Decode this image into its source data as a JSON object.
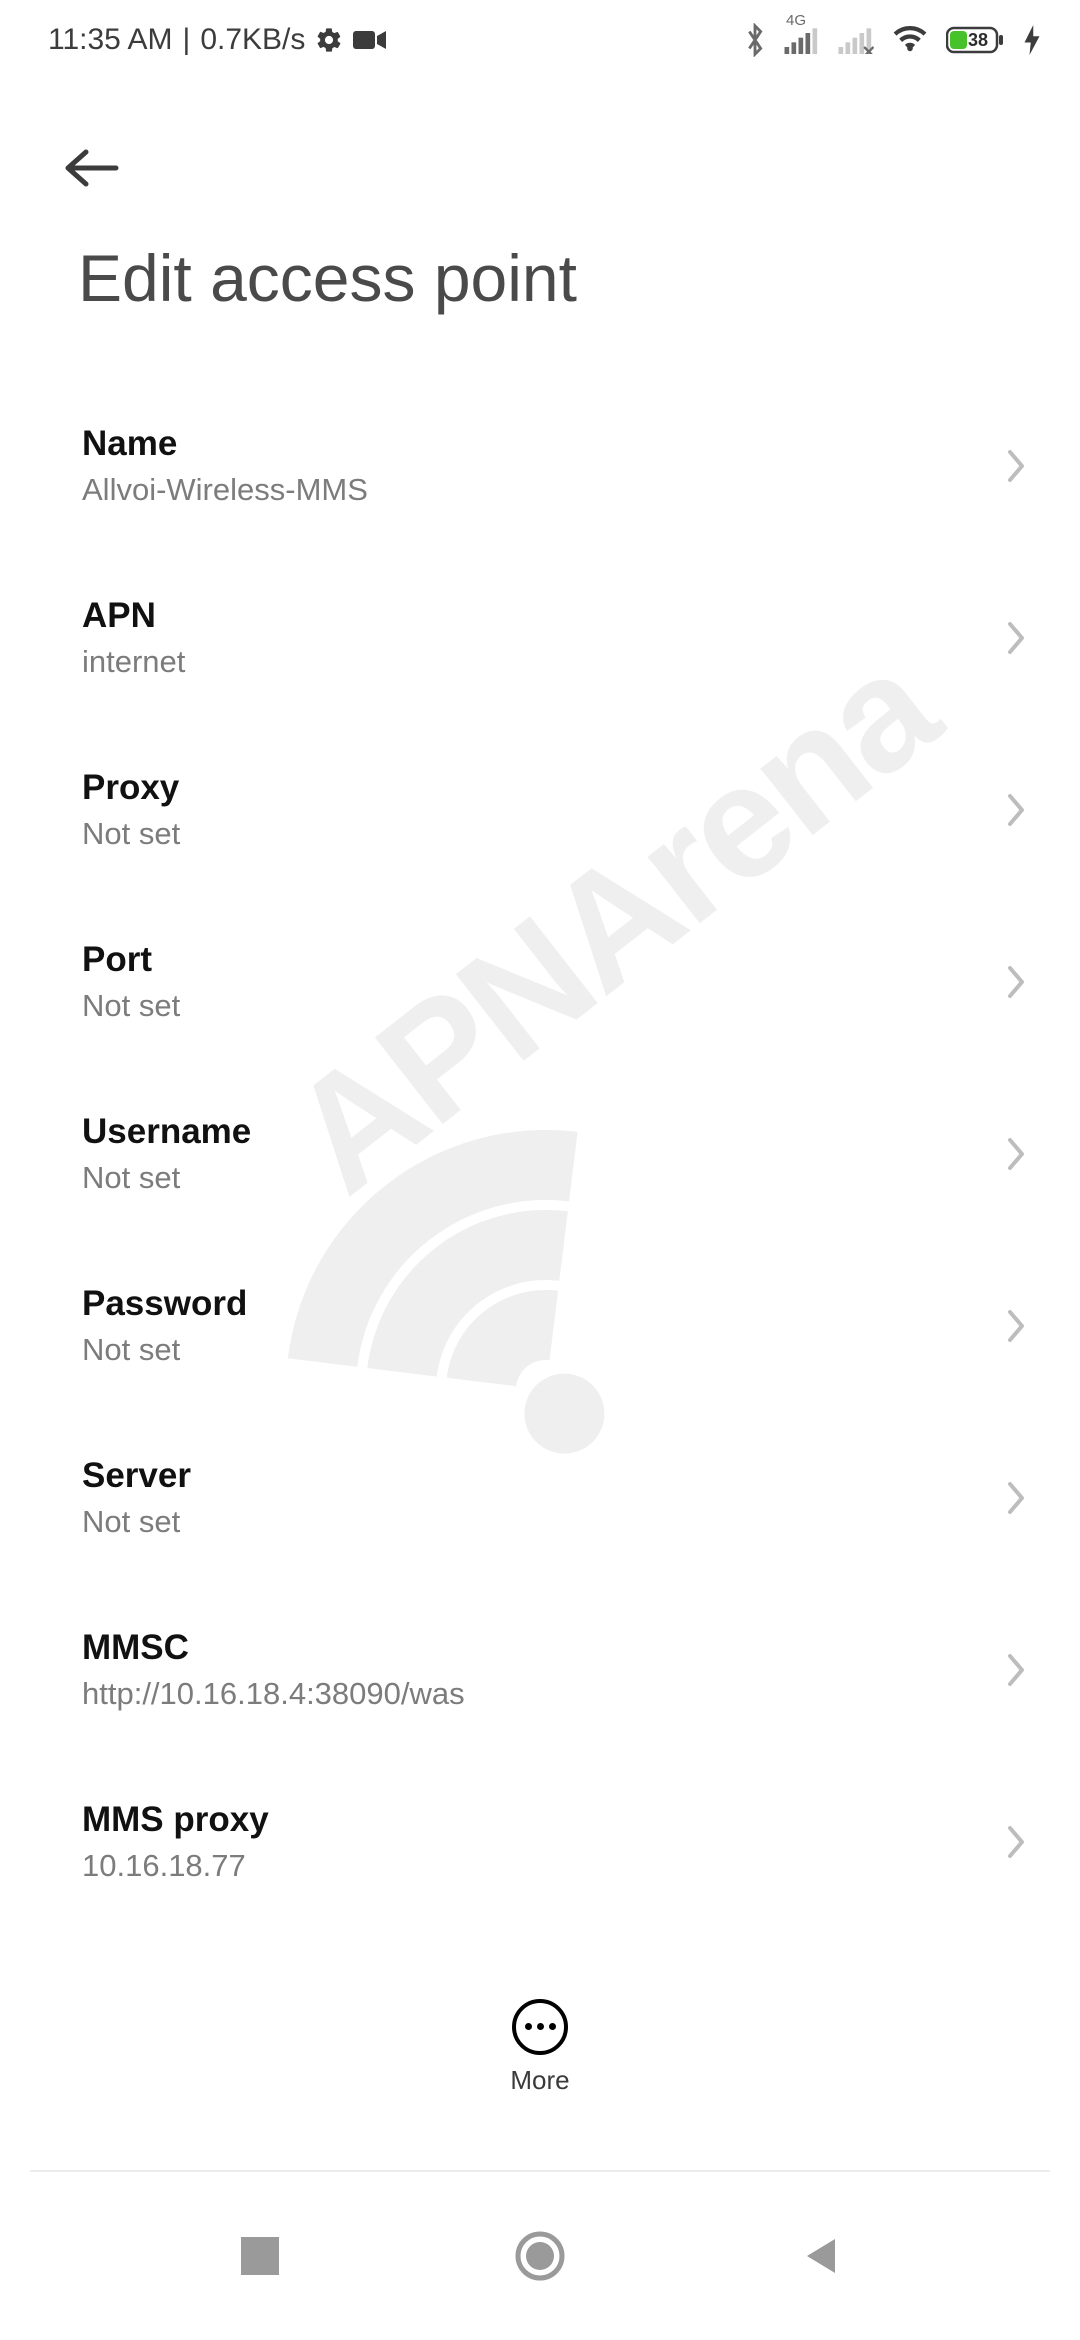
{
  "status": {
    "time": "11:35 AM",
    "net_speed": "0.7KB/s",
    "cell_label": "4G",
    "battery_pct": "38"
  },
  "header": {
    "title": "Edit access point"
  },
  "rows": [
    {
      "label": "Name",
      "value": "Allvoi-Wireless-MMS"
    },
    {
      "label": "APN",
      "value": "internet"
    },
    {
      "label": "Proxy",
      "value": "Not set"
    },
    {
      "label": "Port",
      "value": "Not set"
    },
    {
      "label": "Username",
      "value": "Not set"
    },
    {
      "label": "Password",
      "value": "Not set"
    },
    {
      "label": "Server",
      "value": "Not set"
    },
    {
      "label": "MMSC",
      "value": "http://10.16.18.4:38090/was"
    },
    {
      "label": "MMS proxy",
      "value": "10.16.18.77"
    }
  ],
  "bottom": {
    "more_label": "More"
  },
  "watermark_text": "APNArena"
}
